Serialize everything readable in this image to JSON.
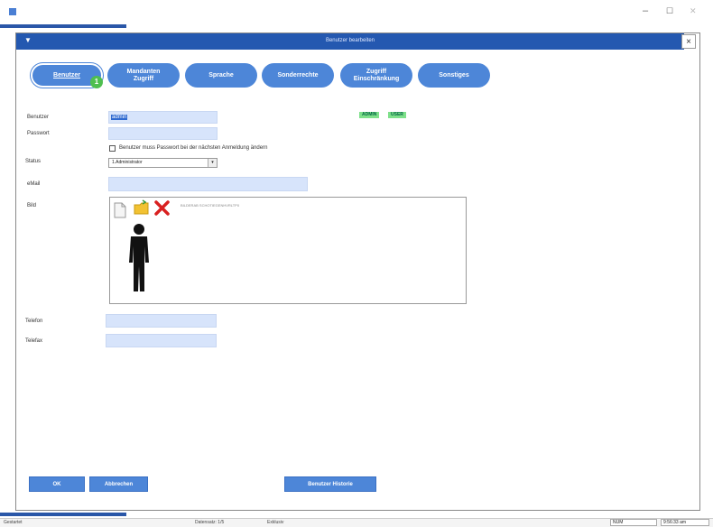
{
  "window": {
    "minimize_label": "–",
    "maximize_label": "☐",
    "close_label": "✕"
  },
  "dialog": {
    "title": "Benutzer bearbeiten",
    "menu_arrow": "▼",
    "close_label": "×"
  },
  "tabs": [
    {
      "label": "Benutzer"
    },
    {
      "label": "Mandanten Zugriff"
    },
    {
      "label": "Sprache"
    },
    {
      "label": "Sonderrechte"
    },
    {
      "label": "Zugriff Einschränkung"
    },
    {
      "label": "Sonstiges"
    }
  ],
  "tab_badge": "1",
  "form": {
    "benutzer_label": "Benutzer",
    "benutzer_value": "admin",
    "passwort_label": "Passwort",
    "passwort_value": "",
    "tags": [
      "ADMIN",
      "USER"
    ],
    "checkbox_label": "Benutzer muss Passwort bei der nächsten Anmeldung ändern",
    "status_label": "Status",
    "status_value": "1.Administrator",
    "email_label": "eMail",
    "email_value": "",
    "bild_label": "Bild",
    "bild_hint": "BILDERAB SCHOTIEGENHVRLTP0",
    "telefon_label": "Telefon",
    "telefon_value": "",
    "telefax_label": "Telefax",
    "telefax_value": ""
  },
  "buttons": {
    "ok": "OK",
    "cancel": "Abbrechen",
    "history": "Benutzer Historie"
  },
  "statusbar": {
    "left": "Gestartet",
    "datensatz": "Datensatz: 1/5",
    "status": "Exklusiv",
    "num": "NUM",
    "time": "9:56:33 am"
  },
  "colors": {
    "accent": "#2458b0",
    "tab": "#4d86d8",
    "field": "#d7e4fb",
    "badge": "#4fbf4f"
  }
}
